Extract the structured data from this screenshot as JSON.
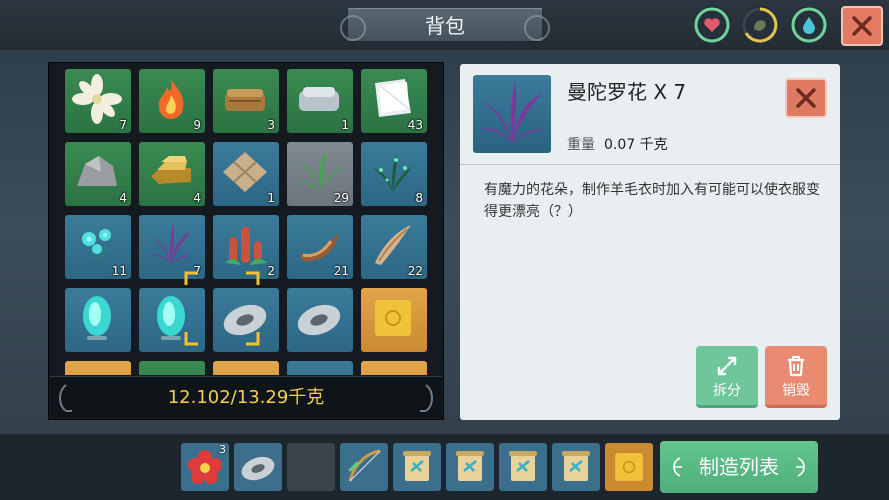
{
  "window": {
    "title": "背包"
  },
  "status": {
    "health": {
      "icon": "heart-icon",
      "color": "#e05a6a"
    },
    "hunger": {
      "icon": "stomach-icon",
      "color": "#e0b84a"
    },
    "thirst": {
      "icon": "water-drop-icon",
      "color": "#4ac6d6"
    }
  },
  "inventory": {
    "slots": [
      {
        "item": "white-flower",
        "count": "7"
      },
      {
        "item": "fire",
        "count": "9"
      },
      {
        "item": "leather",
        "count": "3"
      },
      {
        "item": "cloth",
        "count": "1"
      },
      {
        "item": "paper",
        "count": "43"
      },
      {
        "item": "stone",
        "count": "4"
      },
      {
        "item": "gold-ingot",
        "count": "4"
      },
      {
        "item": "stone-floor",
        "count": "1"
      },
      {
        "item": "grass",
        "count": "29"
      },
      {
        "item": "glowing-plant",
        "count": "8"
      },
      {
        "item": "cyan-flower",
        "count": "11"
      },
      {
        "item": "mandala-flower",
        "count": "7"
      },
      {
        "item": "red-coral",
        "count": "2"
      },
      {
        "item": "horn",
        "count": "21"
      },
      {
        "item": "tusk",
        "count": "22"
      },
      {
        "item": "cyan-crystal",
        "count": ""
      },
      {
        "item": "cyan-crystal",
        "count": ""
      },
      {
        "item": "metal-disc",
        "count": ""
      },
      {
        "item": "metal-disc",
        "count": ""
      },
      {
        "item": "gold-card",
        "count": ""
      }
    ],
    "weight": "12.102/13.29千克"
  },
  "detail": {
    "name": "曼陀罗花 X 7",
    "weight_label": "重量",
    "weight_value": "0.07 千克",
    "description": "有魔力的花朵，制作羊毛衣时加入有可能可以使衣服变得更漂亮（？）",
    "split_label": "拆分",
    "destroy_label": "销毁"
  },
  "hotbar": {
    "slots": [
      {
        "item": "red-flower",
        "count": "3"
      },
      {
        "item": "metal-disc",
        "count": ""
      },
      {
        "item": "empty",
        "count": ""
      },
      {
        "item": "bow",
        "count": ""
      },
      {
        "item": "blueprint-scroll",
        "count": ""
      },
      {
        "item": "blueprint-scroll",
        "count": ""
      },
      {
        "item": "blueprint-scroll",
        "count": ""
      },
      {
        "item": "blueprint-scroll",
        "count": ""
      },
      {
        "item": "gold-card",
        "count": ""
      }
    ],
    "craft_label": "制造列表"
  },
  "colors": {
    "accent_green": "#5fbf8a",
    "accent_red": "#e37b64",
    "weight_text": "#f1d24a"
  }
}
